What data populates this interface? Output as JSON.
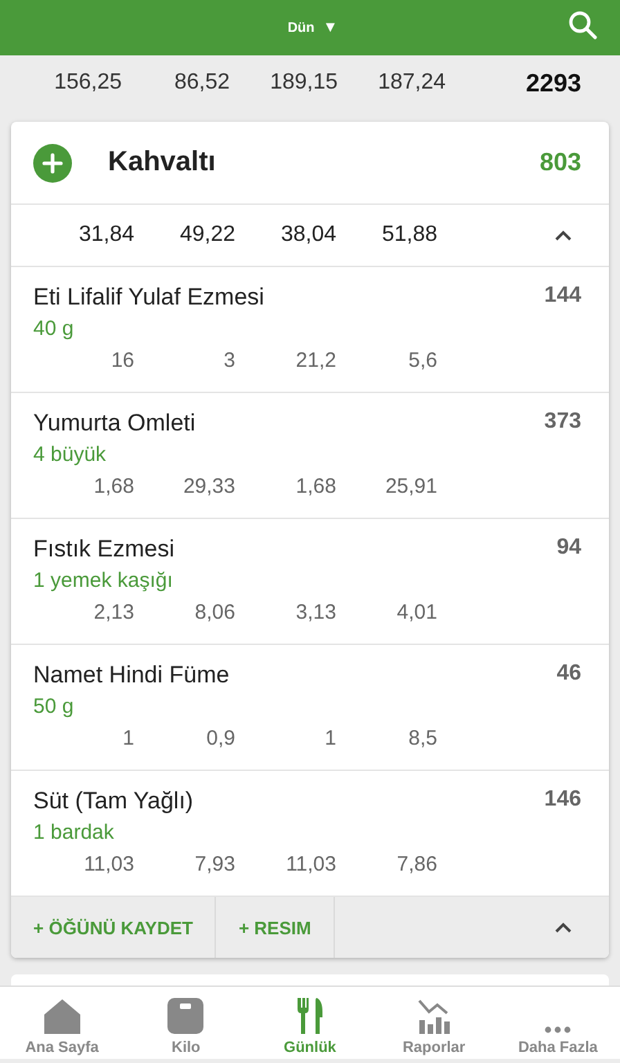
{
  "header": {
    "date": "Dün",
    "caret": "▼"
  },
  "day_totals": {
    "values": [
      "156,25",
      "86,52",
      "189,15",
      "187,24"
    ],
    "calories": "2293"
  },
  "meal": {
    "name": "Kahvaltı",
    "calories": "803",
    "totals": [
      "31,84",
      "49,22",
      "38,04",
      "51,88"
    ],
    "expanded": true,
    "foods": [
      {
        "name": "Eti Lifalif Yulaf Ezmesi",
        "portion": "40 g",
        "calories": "144",
        "values": [
          "16",
          "3",
          "21,2",
          "5,6"
        ]
      },
      {
        "name": "Yumurta Omleti",
        "portion": "4 büyük",
        "calories": "373",
        "values": [
          "1,68",
          "29,33",
          "1,68",
          "25,91"
        ]
      },
      {
        "name": "Fıstık Ezmesi",
        "portion": "1 yemek kaşığı",
        "calories": "94",
        "values": [
          "2,13",
          "8,06",
          "3,13",
          "4,01"
        ]
      },
      {
        "name": "Namet Hindi Füme",
        "portion": "50 g",
        "calories": "46",
        "values": [
          "1",
          "0,9",
          "1",
          "8,5"
        ]
      },
      {
        "name": "Süt (Tam Yağlı)",
        "portion": "1 bardak",
        "calories": "146",
        "values": [
          "11,03",
          "7,93",
          "11,03",
          "7,86"
        ]
      }
    ],
    "actions": [
      "+ ÖĞÜNÜ KAYDET",
      "+ RESIM"
    ]
  },
  "tabs": [
    {
      "label": "Ana Sayfa",
      "kind": "home",
      "selected": false
    },
    {
      "label": "Kilo",
      "kind": "scale",
      "selected": false
    },
    {
      "label": "Günlük",
      "kind": "diary",
      "selected": true
    },
    {
      "label": "Raporlar",
      "kind": "reports",
      "selected": false
    },
    {
      "label": "Daha Fazla",
      "kind": "more",
      "selected": false
    }
  ]
}
